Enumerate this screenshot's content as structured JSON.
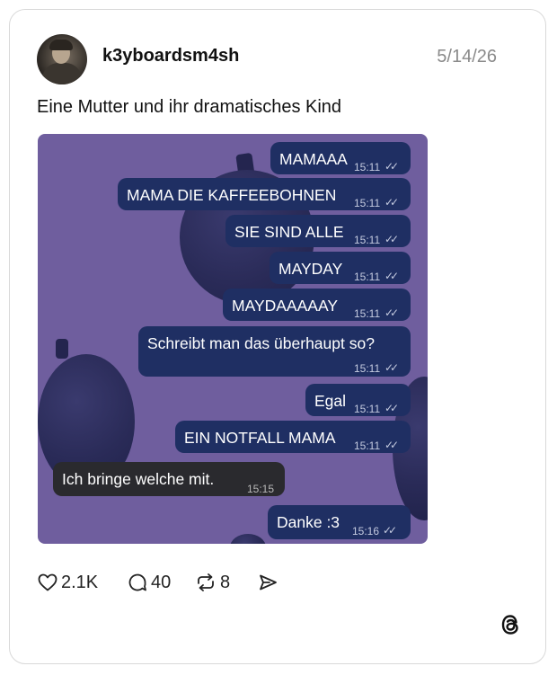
{
  "post": {
    "username": "k3yboardsm4sh",
    "date": "5/14/26",
    "caption": "Eine Mutter und ihr dramatisches Kind"
  },
  "chat": {
    "messages": [
      {
        "text": "MAMAAA",
        "time": "15:11",
        "dir": "out"
      },
      {
        "text": "MAMA DIE KAFFEEBOHNEN",
        "time": "15:11",
        "dir": "out"
      },
      {
        "text": "SIE SIND ALLE",
        "time": "15:11",
        "dir": "out"
      },
      {
        "text": "MAYDAY",
        "time": "15:11",
        "dir": "out"
      },
      {
        "text": "MAYDAAAAAY",
        "time": "15:11",
        "dir": "out"
      },
      {
        "text": "Schreibt man das überhaupt so?",
        "time": "15:11",
        "dir": "out"
      },
      {
        "text": "Egal",
        "time": "15:11",
        "dir": "out"
      },
      {
        "text": "EIN NOTFALL MAMA",
        "time": "15:11",
        "dir": "out"
      },
      {
        "text": "Ich bringe welche mit.",
        "time": "15:15",
        "dir": "in"
      },
      {
        "text": "Danke :3",
        "time": "15:16",
        "dir": "out"
      }
    ],
    "read_mark": "✓✓"
  },
  "actions": {
    "likes": "2.1K",
    "comments": "40",
    "reposts": "8"
  },
  "icons": {
    "like": "heart-icon",
    "comment": "comment-icon",
    "repost": "repost-icon",
    "share": "send-icon",
    "brand": "threads-logo-icon"
  },
  "colors": {
    "chat_background": "#6f5e9e",
    "outgoing_bubble": "#1f2f63",
    "incoming_bubble": "#2a2a2e"
  }
}
